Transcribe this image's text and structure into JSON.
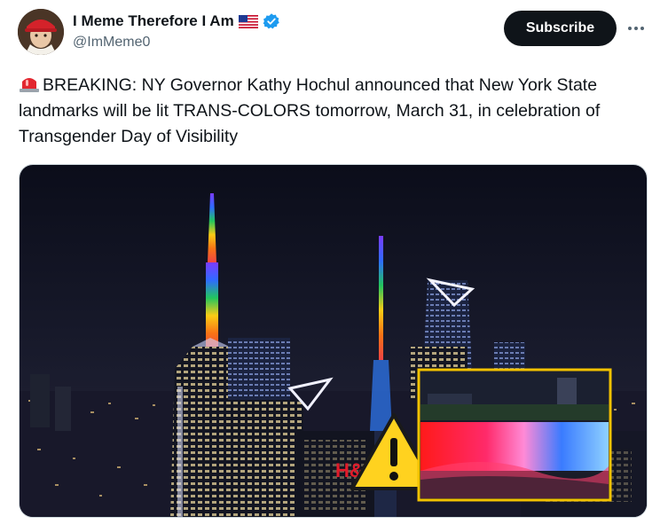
{
  "author": {
    "display_name": "I Meme Therefore I Am",
    "handle": "@ImMeme0",
    "avatar_icon": "avatar-portrait-red-cap",
    "flag_icon": "us-flag-icon",
    "verified_icon": "verified-badge-icon",
    "verified_color": "#1d9bf0"
  },
  "actions": {
    "subscribe_label": "Subscribe",
    "more_icon": "more-options-icon"
  },
  "tweet": {
    "emoji_icon": "rotating-light-icon",
    "text": "BREAKING: NY Governor Kathy Hochul announced that New York State landmarks will be lit TRANS-COLORS tomorrow, March 31, in celebration of Transgender Day of Visibility"
  },
  "media": {
    "sign_text": "H&M",
    "warning_icon": "warning-triangle-icon",
    "inset_border_color": "#f2c200"
  }
}
